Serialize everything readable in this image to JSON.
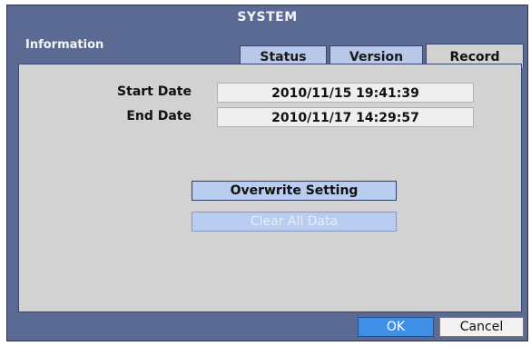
{
  "window": {
    "title": "SYSTEM"
  },
  "section": {
    "label": "Information"
  },
  "tabs": [
    {
      "label": "Status",
      "active": false
    },
    {
      "label": "Version",
      "active": false
    },
    {
      "label": "Record",
      "active": true
    }
  ],
  "fields": {
    "start_date": {
      "label": "Start Date",
      "value": "2010/11/15  19:41:39"
    },
    "end_date": {
      "label": "End Date",
      "value": "2010/11/17  14:29:57"
    }
  },
  "buttons": {
    "overwrite": "Overwrite Setting",
    "clear_all": "Clear All Data",
    "ok": "OK",
    "cancel": "Cancel"
  },
  "colors": {
    "window_bg": "#5a6a92",
    "panel_bg": "#d2d2d2",
    "tab_inactive": "#b7c8e8",
    "ok_button": "#3f8fe6"
  }
}
